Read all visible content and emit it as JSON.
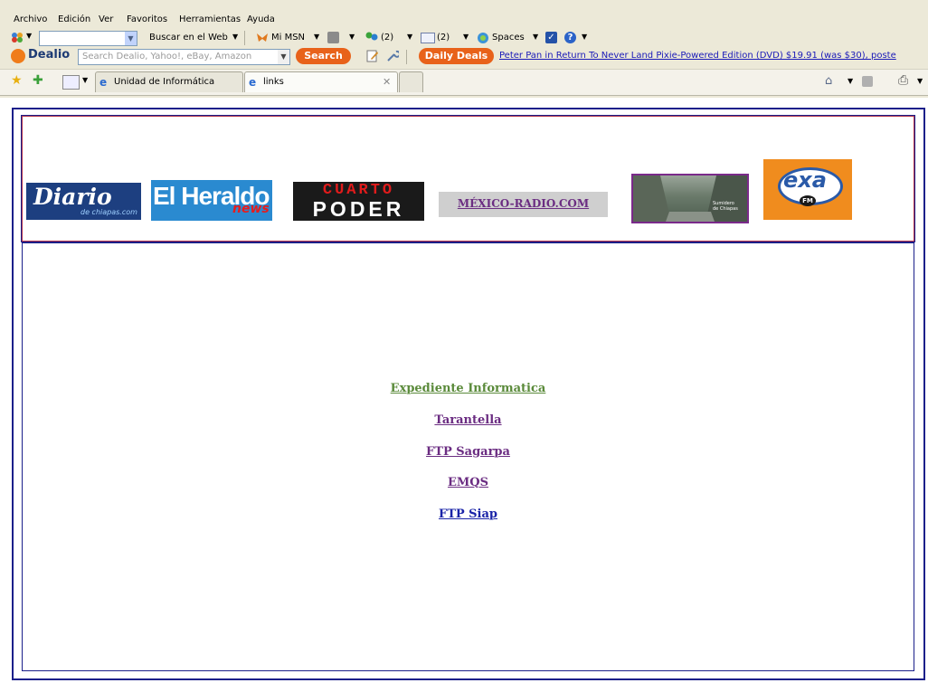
{
  "menu": [
    "Archivo",
    "Edición",
    "Ver",
    "Favoritos",
    "Herramientas",
    "Ayuda"
  ],
  "toolbar1": {
    "search_web": "Buscar en el Web",
    "mimsn": "Mi MSN",
    "contacts_count": "(2)",
    "mail_count": "(2)",
    "spaces": "Spaces"
  },
  "dealio": {
    "brand": "Dealio",
    "placeholder": "Search Dealio, Yahoo!, eBay, Amazon",
    "search_label": "Search",
    "daily_deals": "Daily Deals",
    "ticker": "Peter Pan in Return To Never Land Pixie-Powered Edition (DVD) $19.91 (was $30), poste"
  },
  "tabs": [
    {
      "label": "Unidad de Informática",
      "active": false
    },
    {
      "label": "links",
      "active": true
    }
  ],
  "logos": {
    "diario": {
      "main": "Diario",
      "sub": "de chiapas.com"
    },
    "heraldo": {
      "main": "El Heraldo",
      "sub": "news"
    },
    "cuarto": {
      "line1": "CUARTO",
      "line2": "PODER"
    },
    "mexico_radio": "MÉXICO-RADIO.COM",
    "canyon_caption": "Sumidero de Chiapas",
    "exa": {
      "main": "exa",
      "badge": "FM"
    }
  },
  "links": [
    {
      "label": "Expediente Informatica",
      "color": "#5a8a3a"
    },
    {
      "label": "Tarantella",
      "color": "#6b2d82"
    },
    {
      "label": "FTP Sagarpa",
      "color": "#6b2d82"
    },
    {
      "label": "EMQS",
      "color": "#6b2d82"
    },
    {
      "label": "FTP Siap",
      "color": "#1a24a8"
    }
  ]
}
